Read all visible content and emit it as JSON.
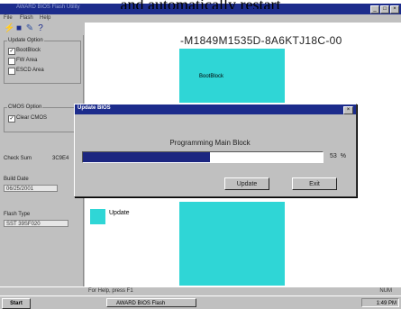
{
  "caption": "and automatically restart",
  "window": {
    "title": "AWARD BIOS Flash Utility"
  },
  "menu": [
    "File",
    "Flash",
    "Help"
  ],
  "toolbar": {
    "icons": [
      "flash-icon",
      "save-icon",
      "tool-icon",
      "help-icon"
    ]
  },
  "left_panel": {
    "update_options_title": "Update Option",
    "options": [
      {
        "label": "BootBlock",
        "checked": true
      },
      {
        "label": "FW Area",
        "checked": false
      },
      {
        "label": "ESCD Area",
        "checked": false
      }
    ],
    "cmos_title": "CMOS Option",
    "cmos_option": {
      "label": "Clear CMOS",
      "checked": true
    },
    "check_sum_label": "Check Sum",
    "check_sum_value": "3C9E4",
    "build_date_label": "Build Date",
    "build_date_value": "06/25/2001",
    "flash_type_label": "Flash Type",
    "flash_type_value": "SST 39SF020"
  },
  "main": {
    "model": "-M1849M1535D-8A6KTJ18C-00",
    "boot_block_label": "BootBlock",
    "legend_label": "Update"
  },
  "dialog": {
    "title": "Update BIOS",
    "message": "Programming Main Block",
    "progress_percent": 53,
    "percent_text": "53",
    "percent_sign": "%",
    "update_button": "Update",
    "exit_button": "Exit"
  },
  "status": {
    "help_text": "For Help, press F1",
    "num_indicator": "NUM"
  },
  "taskbar": {
    "start_label": "Start",
    "task_label": "AWARD BIOS Flash",
    "clock": "1:49 PM"
  }
}
